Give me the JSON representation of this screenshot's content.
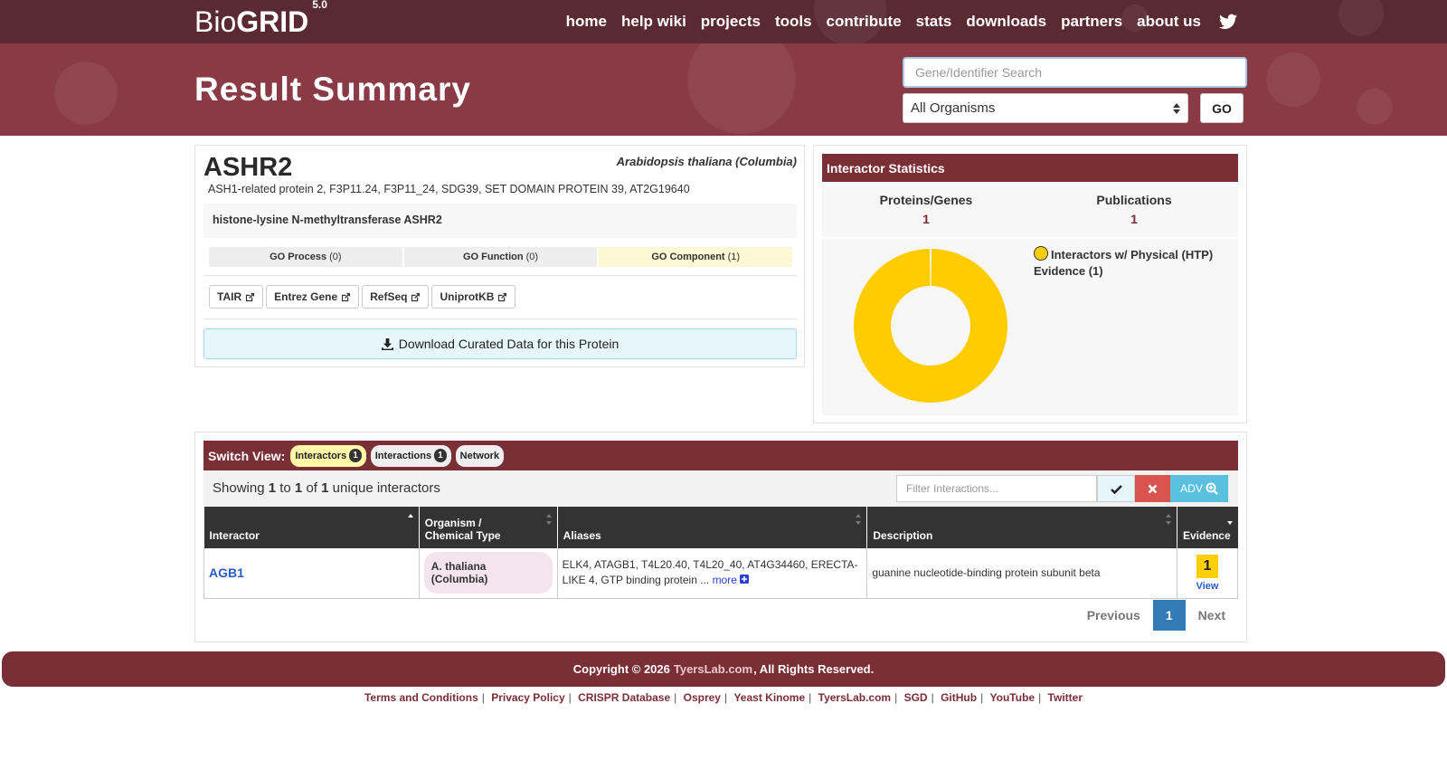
{
  "brand": {
    "prefix": "Bio",
    "bold": "GRID",
    "version": "5.0"
  },
  "nav": [
    "home",
    "help wiki",
    "projects",
    "tools",
    "contribute",
    "stats",
    "downloads",
    "partners",
    "about us"
  ],
  "hero": {
    "title": "Result Summary"
  },
  "search": {
    "placeholder": "Gene/Identifier Search",
    "organism": "All Organisms",
    "go_label": "GO"
  },
  "protein": {
    "name": "ASHR2",
    "organism": "Arabidopsis thaliana (Columbia)",
    "aliases": "ASH1-related protein 2, F3P11.24, F3P11_24, SDG39, SET DOMAIN PROTEIN 39, AT2G19640",
    "description": "histone-lysine N-methyltransferase ASHR2",
    "go": [
      {
        "label": "GO Process",
        "count": "(0)"
      },
      {
        "label": "GO Function",
        "count": "(0)"
      },
      {
        "label": "GO Component",
        "count": "(1)"
      }
    ],
    "links": [
      "TAIR",
      "Entrez Gene",
      "RefSeq",
      "UniprotKB"
    ],
    "download_label": "Download Curated Data for this Protein"
  },
  "stats": {
    "title": "Interactor Statistics",
    "proteins_label": "Proteins/Genes",
    "proteins_value": "1",
    "publications_label": "Publications",
    "publications_value": "1",
    "legend": "Interactors w/ Physical (HTP) Evidence (1)",
    "slice_color": "#ffcc00",
    "slice_fraction": 1.0
  },
  "interactions": {
    "switch_label": "Switch View:",
    "views": [
      {
        "label": "Interactors",
        "count": "1"
      },
      {
        "label": "Interactions",
        "count": "1"
      },
      {
        "label": "Network"
      }
    ],
    "showing": {
      "prefix": "Showing",
      "from": "1",
      "to_word": "to",
      "to": "1",
      "of_word": "of",
      "total": "1",
      "suffix": "unique interactors"
    },
    "filter_placeholder": "Filter Interactions...",
    "adv_label": "ADV",
    "columns": [
      "Interactor",
      "Organism /",
      "Chemical Type",
      "Aliases",
      "Description",
      "Evidence"
    ],
    "rows": [
      {
        "interactor": "AGB1",
        "organism": "A. thaliana (Columbia)",
        "aliases": "ELK4, ATAGB1, T4L20.40, T4L20_40, AT4G34460, ERECTA-LIKE 4, GTP binding protein ...",
        "more": "more",
        "description": "guanine nucleotide-binding protein subunit beta",
        "evidence": "1",
        "view": "View"
      }
    ],
    "pagination": {
      "previous": "Previous",
      "current": "1",
      "next": "Next"
    }
  },
  "footer": {
    "copyright_prefix": "Copyright © 2026",
    "lab": "TyersLab.com",
    "copyright_suffix": ", All Rights Reserved.",
    "links": [
      "Terms and Conditions",
      "Privacy Policy",
      "CRISPR Database",
      "Osprey",
      "Yeast Kinome",
      "TyersLab.com",
      "SGD",
      "GitHub",
      "YouTube",
      "Twitter"
    ]
  }
}
